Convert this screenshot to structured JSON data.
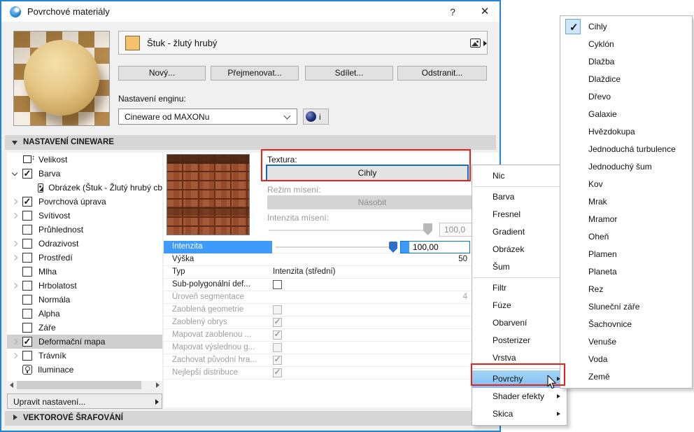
{
  "window": {
    "title": "Povrchové materiály",
    "help": "?",
    "close": "✕"
  },
  "material": {
    "name": "Štuk - žlutý hrubý",
    "swatch_color": "#f6c36b"
  },
  "actions": {
    "new": "Nový...",
    "rename": "Přejmenovat...",
    "share": "Sdílet...",
    "delete": "Odstranit..."
  },
  "engine": {
    "label": "Nastavení enginu:",
    "value": "Cineware od MAXONu",
    "info": "i"
  },
  "sections": {
    "cineware": "NASTAVENÍ CINEWARE",
    "vector": "VEKTOROVÉ ŠRAFOVÁNÍ"
  },
  "tree": {
    "edit_button": "Upravit nastavení...",
    "items": [
      {
        "label": "Velikost"
      },
      {
        "label": "Barva"
      },
      {
        "label": "Obrázek (Štuk - Žlutý hrubý cb"
      },
      {
        "label": "Povrchová úprava"
      },
      {
        "label": "Svítivost"
      },
      {
        "label": "Průhlednost"
      },
      {
        "label": "Odrazivost"
      },
      {
        "label": "Prostředí"
      },
      {
        "label": "Mlha"
      },
      {
        "label": "Hrbolatost"
      },
      {
        "label": "Normála"
      },
      {
        "label": "Alpha"
      },
      {
        "label": "Záře"
      },
      {
        "label": "Deformační mapa"
      },
      {
        "label": "Trávník"
      },
      {
        "label": "Iluminace"
      }
    ]
  },
  "texture": {
    "label": "Textura:",
    "value": "Cihly",
    "blend_mode_label": "Režim mísení:",
    "blend_mode_value": "Násobit",
    "blend_intensity_label": "Intenzita mísení:",
    "blend_intensity_value": "100,0"
  },
  "properties": {
    "rows": [
      {
        "label": "Intenzita",
        "value": "100,00"
      },
      {
        "label": "Výška",
        "value": "50"
      },
      {
        "label": "Typ",
        "value": "Intenzita (střední)"
      },
      {
        "label": "Sub-polygonální def...",
        "value": ""
      },
      {
        "label": "Úroveň segmentace",
        "value": "4"
      },
      {
        "label": "Zaoblená geometrie",
        "value": ""
      },
      {
        "label": "Zaoblený obrys",
        "value": ""
      },
      {
        "label": "Mapovat zaoblenou ...",
        "value": ""
      },
      {
        "label": "Mapovat výslednou g...",
        "value": ""
      },
      {
        "label": "Zachovat původní hra...",
        "value": ""
      },
      {
        "label": "Nejlepší distribuce",
        "value": ""
      }
    ]
  },
  "context_menu": {
    "items": [
      "Nic",
      "Barva",
      "Fresnel",
      "Gradient",
      "Obrázek",
      "Šum",
      "Filtr",
      "Fúze",
      "Obarvení",
      "Posterizer",
      "Vrstva",
      "Povrchy",
      "Shader efekty",
      "Skica"
    ],
    "highlighted": "Povrchy"
  },
  "submenu": {
    "checked_item": "Cihly",
    "items": [
      "Cihly",
      "Cyklón",
      "Dlažba",
      "Dlaždice",
      "Dřevo",
      "Galaxie",
      "Hvězdokupa",
      "Jednoduchá turbulence",
      "Jednoduchý šum",
      "Kov",
      "Mrak",
      "Mramor",
      "Oheň",
      "Plamen",
      "Planeta",
      "Rez",
      "Sluneční záře",
      "Šachovnice",
      "Venuše",
      "Voda",
      "Země"
    ]
  },
  "colors": {
    "accent": "#0078d7",
    "annotation": "#e8211b",
    "selected_row": "#3e9bfb"
  }
}
